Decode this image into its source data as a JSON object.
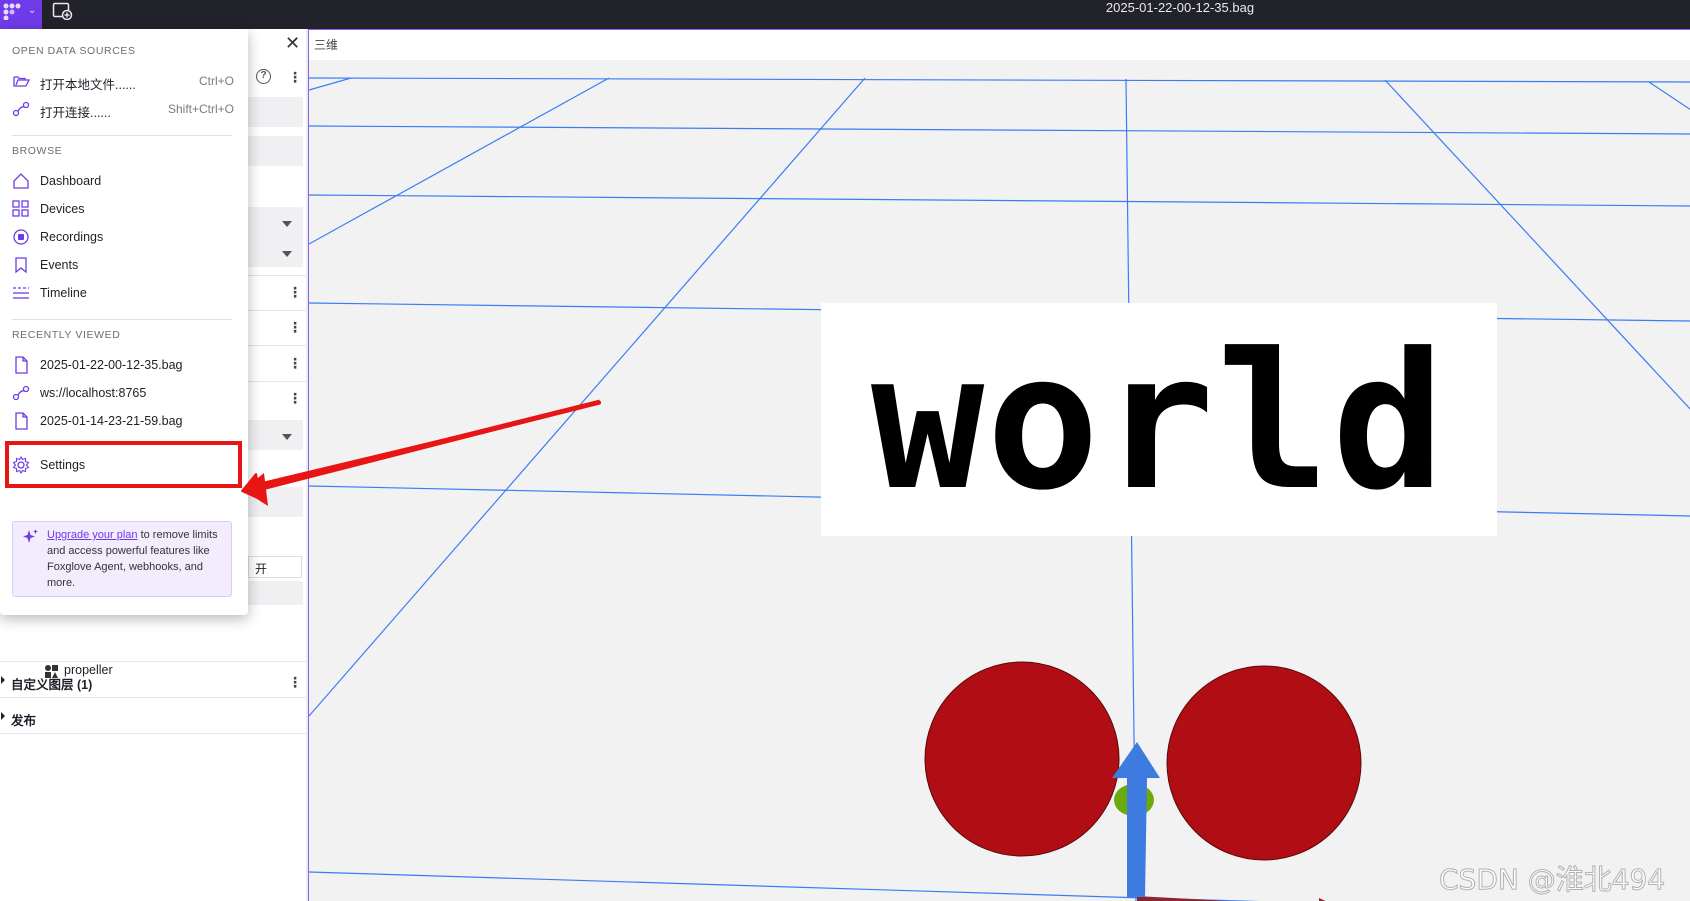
{
  "window": {
    "title": "2025-01-22-00-12-35.bag"
  },
  "topbar": {
    "logo_icon": "foxglove-logo-icon",
    "add_panel_icon": "add-panel-icon"
  },
  "menu": {
    "open_section": "OPEN DATA SOURCES",
    "open_items": [
      {
        "label": "打开本地文件......",
        "shortcut": "Ctrl+O",
        "icon": "folder-open-icon"
      },
      {
        "label": "打开连接......",
        "shortcut": "Shift+Ctrl+O",
        "icon": "connection-icon"
      }
    ],
    "browse_section": "BROWSE",
    "browse_items": [
      {
        "label": "Dashboard",
        "icon": "home-icon"
      },
      {
        "label": "Devices",
        "icon": "grid-icon"
      },
      {
        "label": "Recordings",
        "icon": "record-icon"
      },
      {
        "label": "Events",
        "icon": "bookmark-icon"
      },
      {
        "label": "Timeline",
        "icon": "timeline-icon"
      }
    ],
    "recent_section": "RECENTLY VIEWED",
    "recent_items": [
      {
        "label": "2025-01-22-00-12-35.bag",
        "icon": "file-icon"
      },
      {
        "label": "ws://localhost:8765",
        "icon": "connection-icon"
      },
      {
        "label": "2025-01-14-23-21-59.bag",
        "icon": "file-icon"
      }
    ],
    "settings_label": "Settings",
    "upgrade": {
      "link": "Upgrade your plan",
      "text": " to remove limits and access powerful features like Foxglove Agent, webhooks, and more."
    }
  },
  "sidebar": {
    "close_icon": "close-icon",
    "help_icon": "help-icon",
    "toggle_value": "开",
    "propeller_label": "propeller",
    "custom_layers": "自定义图层 (1)",
    "publish": "发布"
  },
  "viewport": {
    "panel_title": "三维",
    "world_label": "world",
    "watermark": "CSDN @淮北494",
    "colors": {
      "grid": "#3b7cf4",
      "sphere": "#b00d14",
      "axis_z": "#3d7be0",
      "axis_x": "#8b2530",
      "axis_y": "#6aaa0a",
      "highlight": "#e81515"
    }
  }
}
